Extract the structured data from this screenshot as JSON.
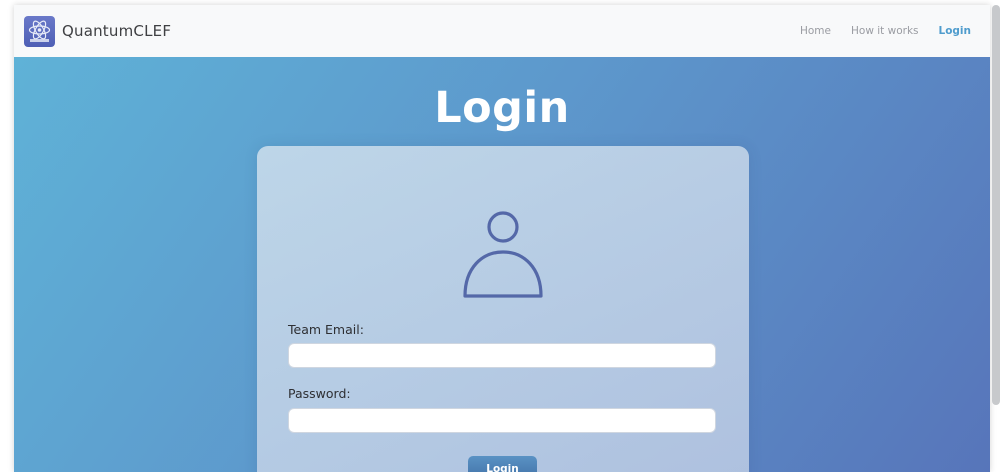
{
  "navbar": {
    "brand": "QuantumCLEF",
    "links": [
      "Home",
      "How it works",
      "Login"
    ],
    "active_link": "Login"
  },
  "main": {
    "title": "Login",
    "form": {
      "email_label": "Team Email:",
      "email_value": "",
      "password_label": "Password:",
      "password_value": "",
      "submit_label": "Login"
    }
  },
  "icons": {
    "brand": "atom-logo-icon",
    "user": "user-icon"
  },
  "colors": {
    "accent": "#4f9ccd",
    "gradient_start": "#5fb2d7",
    "gradient_end": "#5775ba",
    "button": "#4a80b6",
    "icon": "#5468a8"
  }
}
